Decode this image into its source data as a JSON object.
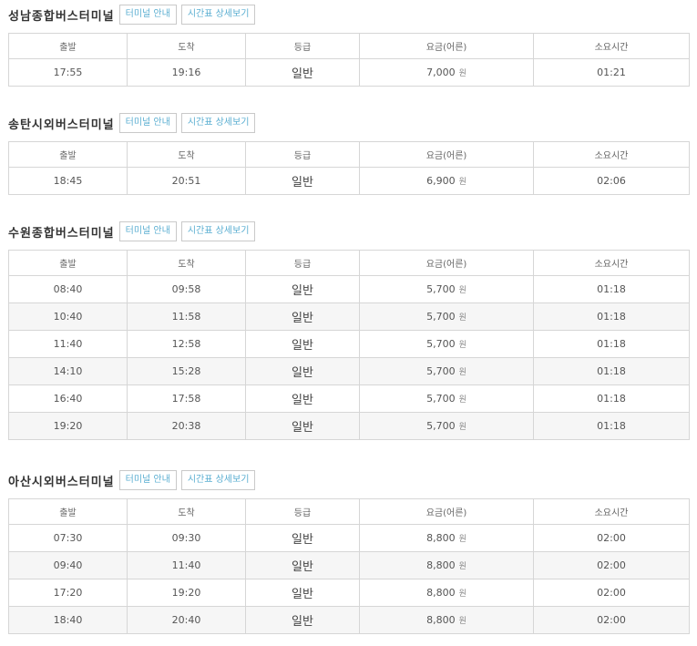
{
  "buttons": {
    "terminal_info": "터미널 안내",
    "timetable_detail": "시간표 상세보기"
  },
  "columns": [
    "출발",
    "도착",
    "등급",
    "요금(어른)",
    "소요시간"
  ],
  "currency_unit": "원",
  "sections": [
    {
      "title": "성남종합버스터미널",
      "rows": [
        {
          "depart": "17:55",
          "arrive": "19:16",
          "grade": "일반",
          "fare": "7,000",
          "duration": "01:21"
        }
      ]
    },
    {
      "title": "송탄시외버스터미널",
      "rows": [
        {
          "depart": "18:45",
          "arrive": "20:51",
          "grade": "일반",
          "fare": "6,900",
          "duration": "02:06"
        }
      ]
    },
    {
      "title": "수원종합버스터미널",
      "rows": [
        {
          "depart": "08:40",
          "arrive": "09:58",
          "grade": "일반",
          "fare": "5,700",
          "duration": "01:18"
        },
        {
          "depart": "10:40",
          "arrive": "11:58",
          "grade": "일반",
          "fare": "5,700",
          "duration": "01:18"
        },
        {
          "depart": "11:40",
          "arrive": "12:58",
          "grade": "일반",
          "fare": "5,700",
          "duration": "01:18"
        },
        {
          "depart": "14:10",
          "arrive": "15:28",
          "grade": "일반",
          "fare": "5,700",
          "duration": "01:18"
        },
        {
          "depart": "16:40",
          "arrive": "17:58",
          "grade": "일반",
          "fare": "5,700",
          "duration": "01:18"
        },
        {
          "depart": "19:20",
          "arrive": "20:38",
          "grade": "일반",
          "fare": "5,700",
          "duration": "01:18"
        }
      ]
    },
    {
      "title": "아산시외버스터미널",
      "rows": [
        {
          "depart": "07:30",
          "arrive": "09:30",
          "grade": "일반",
          "fare": "8,800",
          "duration": "02:00"
        },
        {
          "depart": "09:40",
          "arrive": "11:40",
          "grade": "일반",
          "fare": "8,800",
          "duration": "02:00"
        },
        {
          "depart": "17:20",
          "arrive": "19:20",
          "grade": "일반",
          "fare": "8,800",
          "duration": "02:00"
        },
        {
          "depart": "18:40",
          "arrive": "20:40",
          "grade": "일반",
          "fare": "8,800",
          "duration": "02:00"
        }
      ]
    }
  ]
}
